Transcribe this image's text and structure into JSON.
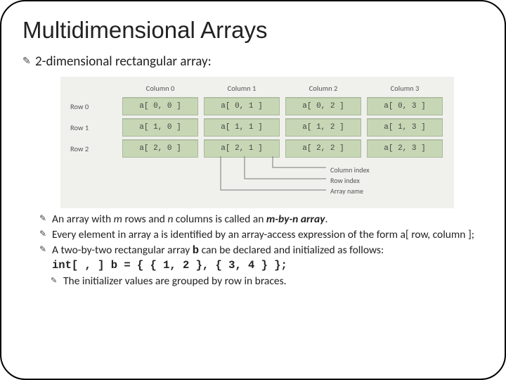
{
  "title": "Multidimensional Arrays",
  "lead": "2-dimensional rectangular array:",
  "diagram": {
    "cols": [
      "Column 0",
      "Column 1",
      "Column 2",
      "Column 3"
    ],
    "rows": [
      "Row 0",
      "Row 1",
      "Row 2"
    ],
    "cells": [
      [
        "a[ 0, 0 ]",
        "a[ 0, 1 ]",
        "a[ 0, 2 ]",
        "a[ 0, 3 ]"
      ],
      [
        "a[ 1, 0 ]",
        "a[ 1, 1 ]",
        "a[ 1, 2 ]",
        "a[ 1, 3 ]"
      ],
      [
        "a[ 2, 0 ]",
        "a[ 2, 1 ]",
        "a[ 2, 2 ]",
        "a[ 2, 3 ]"
      ]
    ],
    "labels": {
      "col_index": "Column index",
      "row_index": "Row index",
      "array_name": "Array name"
    }
  },
  "bullets": {
    "b1_a": "An array with ",
    "b1_m": "m",
    "b1_b": " rows and ",
    "b1_n": "n",
    "b1_c": " columns is called an ",
    "b1_term": "m-by-n array",
    "b1_d": ".",
    "b2": "Every element in array a is identified by an array-access expression of the form a[ row, column ];",
    "b3_a": "A two-by-two rectangular array ",
    "b3_code_b": "b",
    "b3_b": " can be declared and initialized as follows:",
    "code": "int[ , ] b = { { 1, 2 }, { 3, 4 } };",
    "b4": "The initializer values are grouped by row in braces."
  }
}
